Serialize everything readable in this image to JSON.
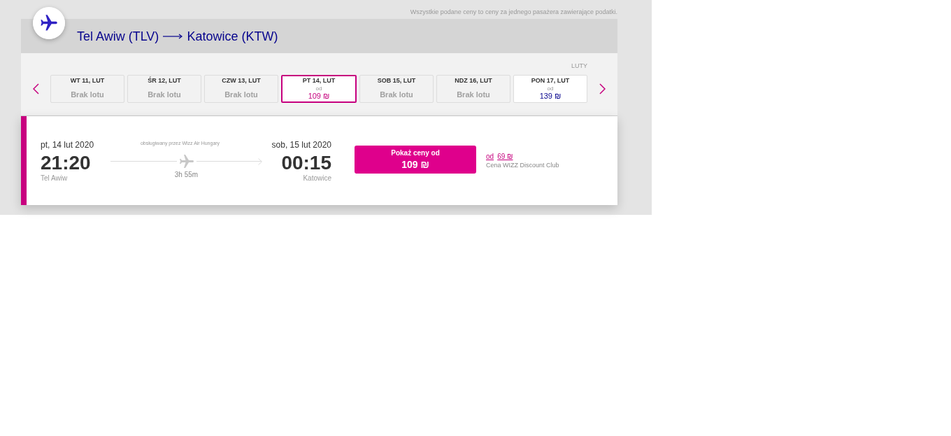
{
  "price_note": "Wszystkie podane ceny to ceny za jednego pasażera zawierające podatki.",
  "route": {
    "origin": "Tel Awiw (TLV)",
    "destination": "Katowice (KTW)"
  },
  "date_strip": {
    "month": "LUTY",
    "days": [
      {
        "label": "WT 11, LUT",
        "kind": "unavailable",
        "status": "Brak lotu",
        "selected": false
      },
      {
        "label": "ŚR 12, LUT",
        "kind": "unavailable",
        "status": "Brak lotu",
        "selected": false
      },
      {
        "label": "CZW 13, LUT",
        "kind": "unavailable",
        "status": "Brak lotu",
        "selected": false
      },
      {
        "label": "PT 14, LUT",
        "kind": "available",
        "from": "od",
        "price": "109 ₪",
        "selected": true
      },
      {
        "label": "SOB 15, LUT",
        "kind": "unavailable",
        "status": "Brak lotu",
        "selected": false
      },
      {
        "label": "NDZ 16, LUT",
        "kind": "unavailable",
        "status": "Brak lotu",
        "selected": false
      },
      {
        "label": "PON 17, LUT",
        "kind": "available",
        "from": "od",
        "price": "139 ₪",
        "selected": false
      }
    ]
  },
  "flight": {
    "departure": {
      "date": "pt, 14 lut 2020",
      "time": "21:20",
      "city": "Tel Awiw"
    },
    "operator": "obsługiwany przez Wizz Air Hungary",
    "duration": "3h 55m",
    "arrival": {
      "date": "sob, 15 lut 2020",
      "time": "00:15",
      "city": "Katowice"
    },
    "price_button": {
      "label": "Pokaż ceny od",
      "price": "109 ₪"
    },
    "club_price": {
      "prefix": "od",
      "price": "69 ₪",
      "label": "Cena WIZZ Discount Club"
    }
  }
}
